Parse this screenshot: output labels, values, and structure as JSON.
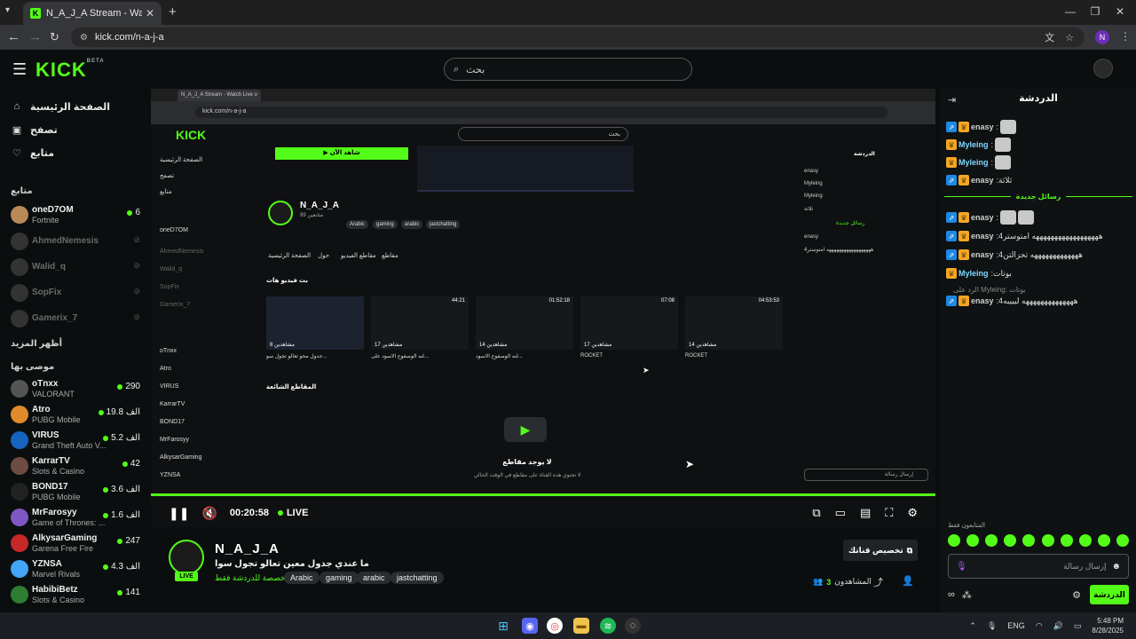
{
  "browser": {
    "tab_title": "N_A_J_A Stream - Watch Live o",
    "url": "kick.com/n-a-j-a"
  },
  "header": {
    "logo": "KICK",
    "logo_tag": "BETA",
    "search_placeholder": "بحث"
  },
  "sidebar": {
    "nav": [
      {
        "label": "الصفحة الرئيسية",
        "icon": "home-icon"
      },
      {
        "label": "تصفح",
        "icon": "browse-icon"
      },
      {
        "label": "متابع",
        "icon": "heart-icon"
      }
    ],
    "following_title": "متابع",
    "following": [
      {
        "name": "oneD7OM",
        "game": "Fortnite",
        "viewers": "6",
        "live": true
      },
      {
        "name": "AhmedNemesis",
        "game": "",
        "viewers": "",
        "live": false
      },
      {
        "name": "Walid_q",
        "game": "",
        "viewers": "",
        "live": false
      },
      {
        "name": "SopFix",
        "game": "",
        "viewers": "",
        "live": false
      },
      {
        "name": "Gamerix_7",
        "game": "",
        "viewers": "",
        "live": false
      }
    ],
    "show_more": "أظهر المزيد",
    "recommended_title": "موصى بها",
    "recommended": [
      {
        "name": "oTnxx",
        "game": "VALORANT",
        "viewers": "290"
      },
      {
        "name": "Atro",
        "game": "PUBG Mobile",
        "viewers": "19.8 الف"
      },
      {
        "name": "VIRUS",
        "game": "Grand Theft Auto V...",
        "viewers": "5.2 الف"
      },
      {
        "name": "KarrarTV",
        "game": "Slots & Casino",
        "viewers": "42"
      },
      {
        "name": "BOND17",
        "game": "PUBG Mobile",
        "viewers": "3.6 الف"
      },
      {
        "name": "MrFarosyy",
        "game": "Game of Thrones: ...",
        "viewers": "1.6 الف"
      },
      {
        "name": "AlkysarGaming",
        "game": "Garena Free Fire",
        "viewers": "247"
      },
      {
        "name": "YZNSA",
        "game": "Marvel Rivals",
        "viewers": "4.3 الف"
      },
      {
        "name": "HabibiBetz",
        "game": "Slots & Casino",
        "viewers": "141"
      }
    ]
  },
  "inner_capture": {
    "tab_title": "N_A_J_A Stream - Watch Live o",
    "url": "kick.com/n-a-j-a",
    "green_button": "▶ شاهد الآن",
    "channel_name": "N_A_J_A",
    "followers_line": "99 متابعين",
    "tags": [
      "Arabic",
      "gaming",
      "arabic",
      "jastchatting"
    ],
    "menu": [
      "الصفحة الرئيسية",
      "حول",
      "مقاطع الفيديو",
      "مقاطع"
    ],
    "videos_heading": "بث فيديو هات",
    "thumbs": [
      {
        "dur": "",
        "views": "مشاهدين 8",
        "title": "جدول محو تعالو تجول سو..."
      },
      {
        "dur": "44:21",
        "views": "مشاهدين 17",
        "title": "لنه الوصفوح الاسود على..."
      },
      {
        "dur": "01:52:18",
        "views": "مشاهدين 14",
        "title": "لنه الوصفوح الاسود..."
      },
      {
        "dur": "07:08",
        "views": "مشاهدين 17",
        "title": "ROCKET"
      },
      {
        "dur": "04:53:53",
        "views": "مشاهدين 14",
        "title": "ROCKET"
      }
    ],
    "clips_heading": "المقاطع الشائعة",
    "no_clips": "لا يوجد مقاطع",
    "no_clips_sub": "لا تحتوي هذه القناة على مقاطع في الوقت الحالي",
    "chat_title": "الدردشة",
    "chat_input": "إرسال رسالة"
  },
  "player": {
    "time": "00:20:58",
    "live_label": "LIVE"
  },
  "stream": {
    "name": "N_A_J_A",
    "title": "ما عندي جدول معين تعالو تجول سوا",
    "followers_only": "مخصصة للدردشة فقط",
    "tags": [
      "Arabic",
      "gaming",
      "arabic",
      "jastchatting"
    ],
    "customize_button": "تخصيص قناتك",
    "viewers_label": "المشاهدون",
    "viewers_count": "3",
    "live_badge": "LIVE"
  },
  "chat": {
    "title": "الدردشة",
    "messages": [
      {
        "user": "enasy",
        "text": "",
        "badge": "blue",
        "color": "#cfcfcf",
        "emotes": 1
      },
      {
        "user": "Myleing",
        "text": "",
        "badge": "gold",
        "color": "#7fd7ff",
        "emotes": 1
      },
      {
        "user": "Myleing",
        "text": "",
        "badge": "gold",
        "color": "#7fd7ff",
        "emotes": 1
      },
      {
        "user": "enasy",
        "text": "ثلاثة",
        "badge": "blue",
        "color": "#cfcfcf",
        "emotes": 0
      }
    ],
    "new_messages_label": "رسائل جديدة",
    "messages2": [
      {
        "user": "enasy",
        "text": "",
        "badge": "blue",
        "color": "#cfcfcf",
        "emotes": 2
      },
      {
        "user": "enasy",
        "text": "4ههههههههههههههههههه امتوستر",
        "badge": "blue",
        "color": "#cfcfcf",
        "emotes": 0
      },
      {
        "user": "enasy",
        "text": "4هههههههههههههه تحزالتن",
        "badge": "blue",
        "color": "#cfcfcf",
        "emotes": 0
      },
      {
        "user": "Myleing",
        "text": "بوتات",
        "badge": "gold",
        "color": "#7fd7ff",
        "emotes": 0
      }
    ],
    "reply_note": "الرد على Myleing: بوتات",
    "messages3": [
      {
        "user": "enasy",
        "text": "4ههههههههههههههه ليبيبه",
        "badge": "blue",
        "color": "#cfcfcf",
        "emotes": 0
      }
    ],
    "followers_only": "المتابعون فقط",
    "input_placeholder": "إرسال رسالة",
    "send_button": "الدردشة"
  },
  "taskbar": {
    "language": "ENG",
    "time": "5:48 PM",
    "date": "8/28/2025"
  },
  "colors": {
    "accent": "#53fc18",
    "background": "#0b0e0f"
  }
}
